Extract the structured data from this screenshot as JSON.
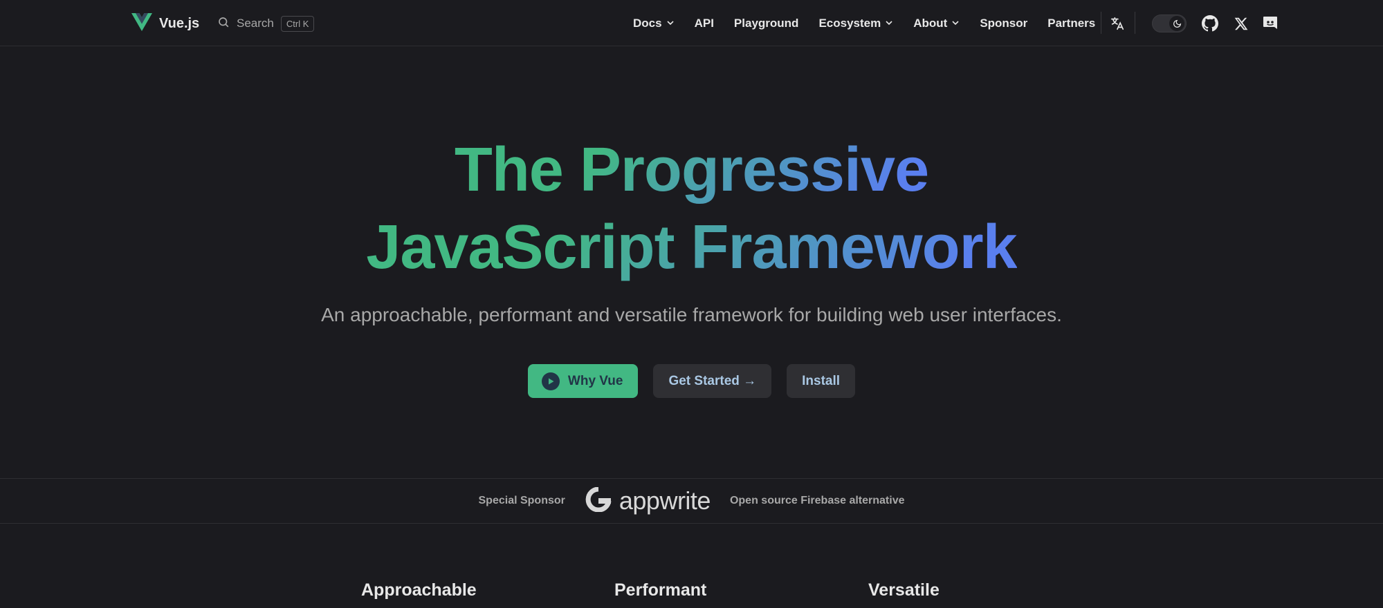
{
  "nav": {
    "brand": "Vue.js",
    "search": {
      "label": "Search",
      "shortcut": "Ctrl K"
    },
    "menu": [
      {
        "label": "Docs",
        "dropdown": true
      },
      {
        "label": "API",
        "dropdown": false
      },
      {
        "label": "Playground",
        "dropdown": false
      },
      {
        "label": "Ecosystem",
        "dropdown": true
      },
      {
        "label": "About",
        "dropdown": true
      },
      {
        "label": "Sponsor",
        "dropdown": false
      },
      {
        "label": "Partners",
        "dropdown": false
      }
    ],
    "icons": [
      "translate-icon",
      "moon-icon",
      "github-icon",
      "x-icon",
      "discord-icon"
    ]
  },
  "hero": {
    "title_line1": "The Progressive",
    "title_line2": "JavaScript Framework",
    "subtitle": "An approachable, performant and versatile framework for building web user interfaces.",
    "buttons": {
      "why": "Why Vue",
      "start": "Get Started →",
      "install": "Install"
    }
  },
  "sponsor": {
    "label": "Special Sponsor",
    "name": "appwrite",
    "tagline": "Open source Firebase alternative"
  },
  "features": [
    "Approachable",
    "Performant",
    "Versatile"
  ],
  "colors": {
    "brand": "#42b883",
    "gradient_end": "#5a7fef",
    "background": "#1b1b1f"
  }
}
